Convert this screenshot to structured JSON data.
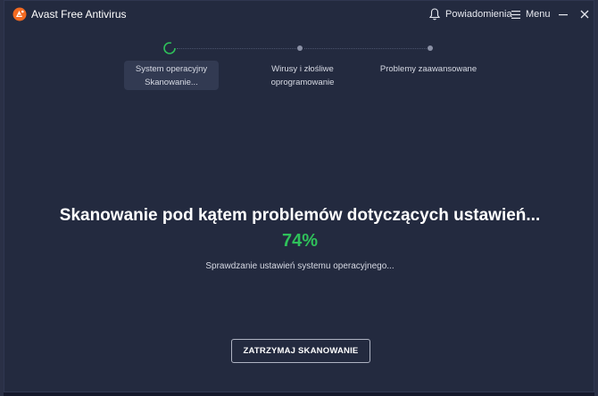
{
  "window": {
    "title": "Avast Free Antivirus",
    "notifications_label": "Powiadomienia",
    "menu_label": "Menu",
    "accent_color": "#f26a21"
  },
  "steps": [
    {
      "line1": "System operacyjny",
      "line2": "Skanowanie...",
      "state": "active"
    },
    {
      "line1": "Wirusy i złośliwe",
      "line2": "oprogramowanie",
      "state": "pending"
    },
    {
      "line1": "Problemy zaawansowane",
      "line2": "",
      "state": "pending"
    }
  ],
  "scan": {
    "headline": "Skanowanie pod kątem problemów dotyczących ustawień...",
    "percent_text": "74%",
    "progress": 0.74,
    "status": "Sprawdzanie ustawień systemu operacyjnego...",
    "stop_label": "ZATRZYMAJ SKANOWANIE",
    "progress_color": "#2fc15a"
  }
}
